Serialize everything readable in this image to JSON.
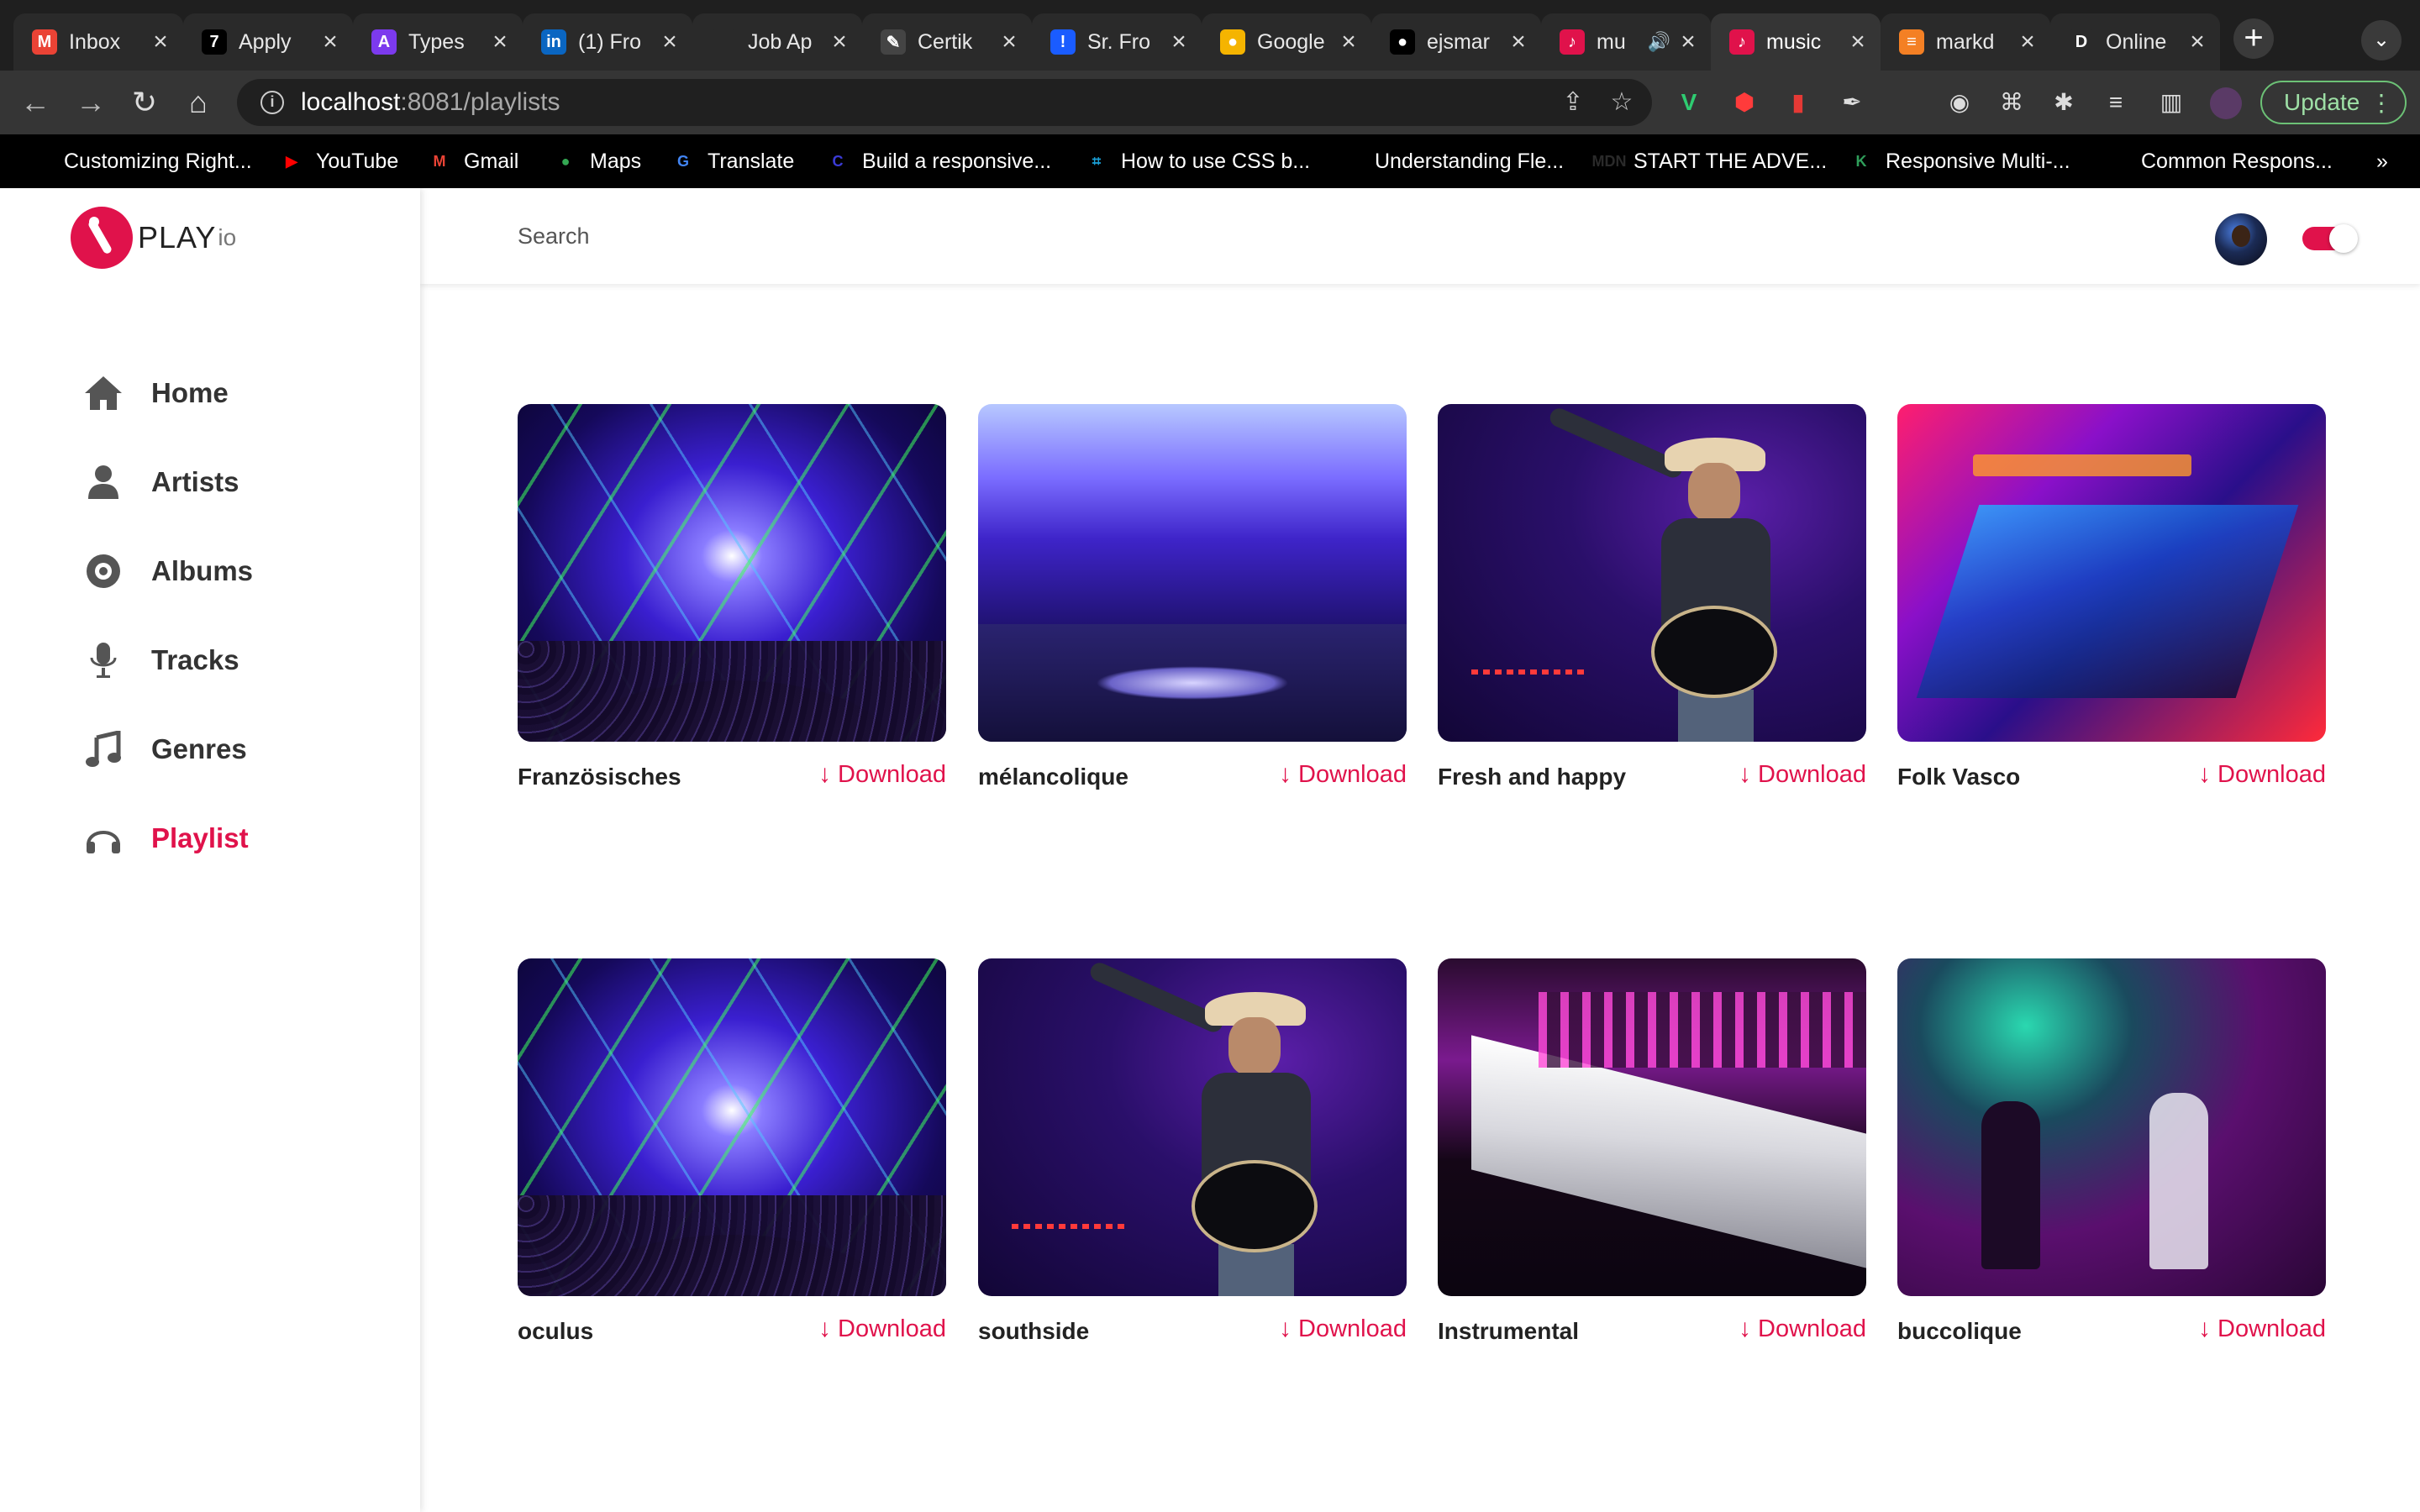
{
  "browser": {
    "tabs": [
      {
        "title": "Inbox",
        "icon": "gmail-icon",
        "color": "#ea4335",
        "glyph": "M"
      },
      {
        "title": "Apply",
        "icon": "apply-icon",
        "color": "#000000",
        "glyph": "7"
      },
      {
        "title": "Types",
        "icon": "types-icon",
        "color": "#7c3aed",
        "glyph": "A"
      },
      {
        "title": "(1) Fro",
        "icon": "linkedin-icon",
        "color": "#0a66c2",
        "glyph": "in"
      },
      {
        "title": "Job Ap",
        "icon": "job-icon",
        "color": "#2a2a2a",
        "glyph": ""
      },
      {
        "title": "Certik",
        "icon": "pen-icon",
        "color": "#444444",
        "glyph": "✎"
      },
      {
        "title": "Sr. Fro",
        "icon": "alert-icon",
        "color": "#1a5cff",
        "glyph": "!"
      },
      {
        "title": "Google",
        "icon": "keep-icon",
        "color": "#f5b400",
        "glyph": "●"
      },
      {
        "title": "ejsmar",
        "icon": "github-icon",
        "color": "#000000",
        "glyph": "●"
      },
      {
        "title": "mu",
        "icon": "music-app-icon",
        "color": "#e0124b",
        "glyph": "♪"
      },
      {
        "title": "music",
        "icon": "music-app-icon",
        "color": "#e0124b",
        "glyph": "♪"
      },
      {
        "title": "markd",
        "icon": "markdown-icon",
        "color": "#f48024",
        "glyph": "≡"
      },
      {
        "title": "Online",
        "icon": "d-icon",
        "color": "#2a2a2a",
        "glyph": "D"
      }
    ],
    "url": {
      "host": "localhost",
      "path": ":8081/playlists"
    },
    "update_label": "Update",
    "bookmarks": [
      {
        "label": "Customizing Right...",
        "icon": "none"
      },
      {
        "label": "YouTube",
        "icon": "youtube-icon",
        "color": "#ff0000",
        "glyph": "▶"
      },
      {
        "label": "Gmail",
        "icon": "gmail-icon",
        "color": "#ea4335",
        "glyph": "M"
      },
      {
        "label": "Maps",
        "icon": "maps-icon",
        "color": "#34a853",
        "glyph": "●"
      },
      {
        "label": "Translate",
        "icon": "translate-icon",
        "color": "#4285f4",
        "glyph": "G"
      },
      {
        "label": "Build a responsive...",
        "icon": "c-icon",
        "color": "#3b3bd6",
        "glyph": "C"
      },
      {
        "label": "How to use CSS b...",
        "icon": "flex-icon",
        "color": "#1a9fd6",
        "glyph": "⌗"
      },
      {
        "label": "Understanding Fle...",
        "icon": "medium-icon",
        "color": "#000000",
        "glyph": "M"
      },
      {
        "label": "START THE ADVE...",
        "icon": "mdn-icon",
        "color": "#2a2a2a",
        "glyph": "MDN"
      },
      {
        "label": "Responsive Multi-...",
        "icon": "leaf-icon",
        "color": "#2f9e5a",
        "glyph": "K"
      },
      {
        "label": "Common Respons...",
        "icon": "dots-icon",
        "color": "#000000",
        "glyph": "●●"
      }
    ]
  },
  "app": {
    "logo": {
      "text": "PLAY",
      "sub": "io"
    },
    "nav": [
      {
        "label": "Home",
        "icon": "home-icon",
        "active": false
      },
      {
        "label": "Artists",
        "icon": "user-icon",
        "active": false
      },
      {
        "label": "Albums",
        "icon": "disc-icon",
        "active": false
      },
      {
        "label": "Tracks",
        "icon": "microphone-icon",
        "active": false
      },
      {
        "label": "Genres",
        "icon": "music-note-icon",
        "active": false
      },
      {
        "label": "Playlist",
        "icon": "headphones-icon",
        "active": true
      }
    ],
    "search": {
      "placeholder": "Search"
    },
    "accent": "#e0124b",
    "download_label": "Download",
    "playlists": [
      {
        "title": "Französisches",
        "art": "laser"
      },
      {
        "title": "mélancolique",
        "art": "lounge"
      },
      {
        "title": "Fresh and happy",
        "art": "concert"
      },
      {
        "title": "Folk Vasco",
        "art": "club"
      },
      {
        "title": "oculus",
        "art": "laser"
      },
      {
        "title": "southside",
        "art": "concert"
      },
      {
        "title": "Instrumental",
        "art": "barwhite"
      },
      {
        "title": "buccolique",
        "art": "band"
      }
    ]
  }
}
